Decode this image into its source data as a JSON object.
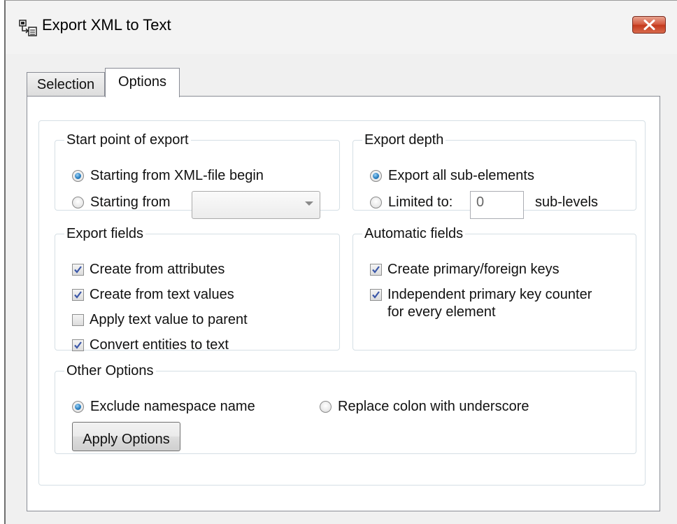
{
  "window": {
    "title": "Export XML to Text"
  },
  "tabs": [
    {
      "label": "Selection",
      "active": false
    },
    {
      "label": "Options",
      "active": true
    }
  ],
  "start_point": {
    "legend": "Start point of export",
    "option_begin": "Starting from XML-file begin",
    "option_from": "Starting from",
    "selected": "option_begin",
    "combo_value": ""
  },
  "export_depth": {
    "legend": "Export depth",
    "option_all": "Export all sub-elements",
    "option_limited": "Limited to:",
    "limit_value": "0",
    "suffix": "sub-levels",
    "selected": "option_all"
  },
  "export_fields": {
    "legend": "Export fields",
    "items": [
      {
        "label": "Create from attributes",
        "checked": true
      },
      {
        "label": "Create from text values",
        "checked": true
      },
      {
        "label": "Apply text value to parent",
        "checked": false
      },
      {
        "label": "Convert entities to text",
        "checked": true
      }
    ]
  },
  "automatic_fields": {
    "legend": "Automatic fields",
    "items": [
      {
        "label": "Create primary/foreign keys",
        "checked": true
      },
      {
        "label": "Independent primary key counter",
        "label2": "for every element",
        "checked": true
      }
    ]
  },
  "other_options": {
    "legend": "Other Options",
    "option_exclude": "Exclude namespace name",
    "option_replace": "Replace colon with underscore",
    "selected": "option_exclude",
    "apply_button": "Apply Options"
  },
  "colors": {
    "close_button": "#c3381c",
    "radio_selected": "#2a7fc0",
    "checkmark": "#3b57a8"
  }
}
